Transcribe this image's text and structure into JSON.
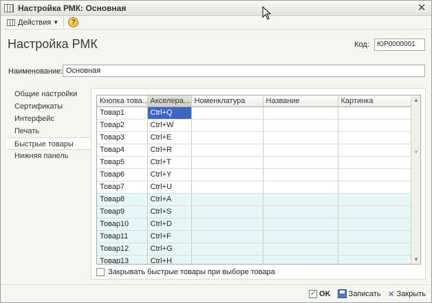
{
  "window": {
    "title": "Настройка РМК: Основная"
  },
  "toolbar": {
    "actions_label": "Действия",
    "help_glyph": "?"
  },
  "form": {
    "title": "Настройка РМК",
    "code_label": "Код:",
    "code_value": "ЮР0000001",
    "name_label": "Наименование:",
    "name_value": "Основная"
  },
  "sidebar": {
    "items": [
      {
        "label": "Общие настройки"
      },
      {
        "label": "Сертификаты"
      },
      {
        "label": "Интерфейс"
      },
      {
        "label": "Печать"
      },
      {
        "label": "Быстрые товары"
      },
      {
        "label": "Нижняя панель"
      }
    ],
    "active_index": 4
  },
  "grid": {
    "columns": [
      "Кнопка това...",
      "Акселера...",
      "Номенклатура",
      "Название",
      "Картинка"
    ],
    "rows": [
      [
        "Товар1",
        "Ctrl+Q",
        "",
        "",
        ""
      ],
      [
        "Товар2",
        "Ctrl+W",
        "",
        "",
        ""
      ],
      [
        "Товар3",
        "Ctrl+E",
        "",
        "",
        ""
      ],
      [
        "Товар4",
        "Ctrl+R",
        "",
        "",
        ""
      ],
      [
        "Товар5",
        "Ctrl+T",
        "",
        "",
        ""
      ],
      [
        "Товар6",
        "Ctrl+Y",
        "",
        "",
        ""
      ],
      [
        "Товар7",
        "Ctrl+U",
        "",
        "",
        ""
      ],
      [
        "Товар8",
        "Ctrl+A",
        "",
        "",
        ""
      ],
      [
        "Товар9",
        "Ctrl+S",
        "",
        "",
        ""
      ],
      [
        "Товар10",
        "Ctrl+D",
        "",
        "",
        ""
      ],
      [
        "Товар11",
        "Ctrl+F",
        "",
        "",
        ""
      ],
      [
        "Товар12",
        "Ctrl+G",
        "",
        "",
        ""
      ],
      [
        "Товар13",
        "Ctrl+H",
        "",
        "",
        ""
      ]
    ],
    "selected_row": 0,
    "selected_col": 1
  },
  "checkbox": {
    "label": "Закрывать быстрые товары при выборе товара",
    "checked": false
  },
  "footer": {
    "ok_label": "OK",
    "save_label": "Записать",
    "close_label": "Закрыть"
  },
  "colors": {
    "selection": "#3e66c4",
    "alt_row": "#e6f7f8",
    "background": "#f6f6f1"
  }
}
